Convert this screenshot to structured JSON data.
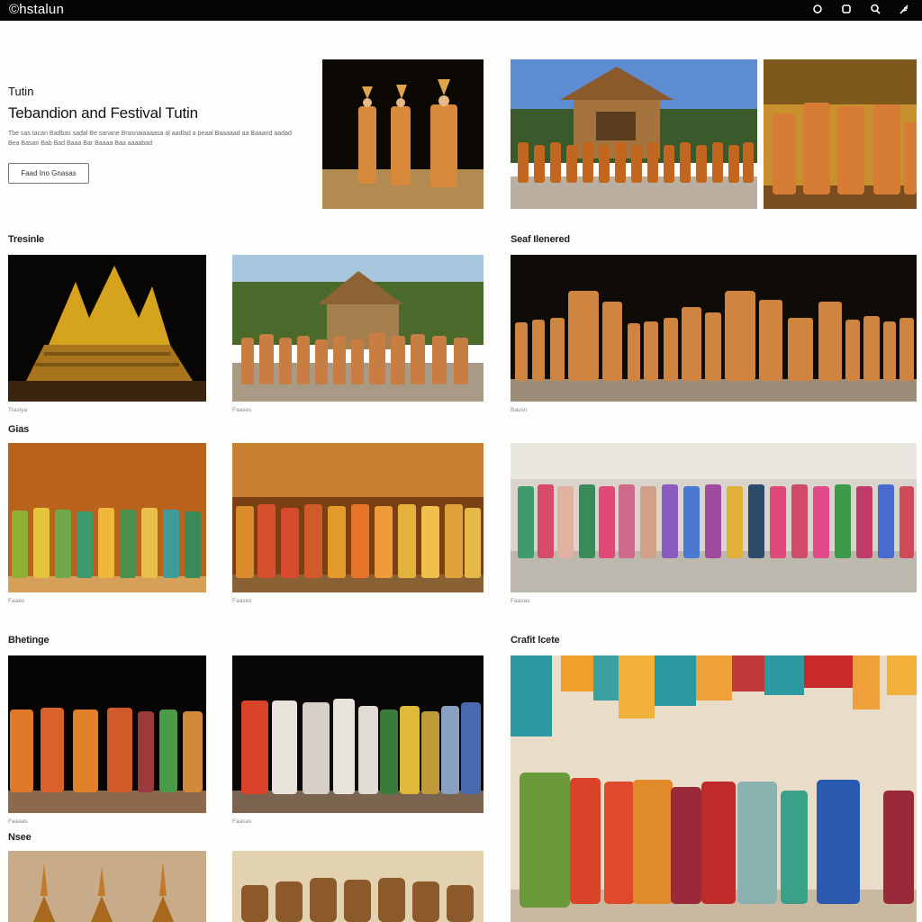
{
  "header": {
    "brand": "©hstalun",
    "icons": [
      "circle-icon",
      "square-icon",
      "search-icon",
      "feather-icon"
    ]
  },
  "hero": {
    "eyebrow": "Tutin",
    "title": "Tebandion and Festival Tutin",
    "description": "Tbe sas tacan Badbas sadal Be sanane Brasnaiaaaasa al aadlad a peaal Baaaaad aa Baaand aadad Bea Basan Bab Bad Baaa Bar Baaaa Baa aaaabad",
    "button_label": "Faad Ino Gnasas"
  },
  "sections": {
    "s1": "Tresinle",
    "s2": "Seaf Ilenered",
    "s3": "Gias",
    "s4": "Bhetinge",
    "s5": "Crafit lcete",
    "s6": "Nsee"
  },
  "captions": {
    "c1": "Trasiya",
    "c2": "Faases",
    "c3": "Bausn",
    "c4": "Faaas",
    "c5": "Faases",
    "c6": "Faasas",
    "c7": "Faaaas",
    "c8": "Faasas"
  },
  "colors": {
    "topbar": "#050505",
    "saffron": "#d88a3a",
    "ochre": "#c2651e",
    "gold": "#d6a31f"
  }
}
